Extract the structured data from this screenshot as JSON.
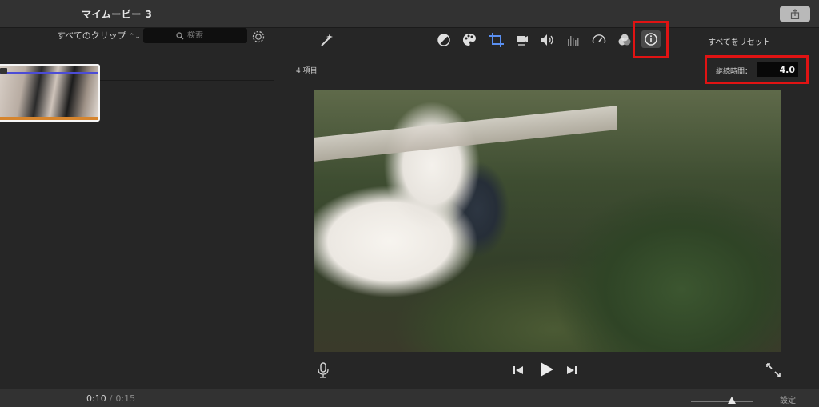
{
  "window": {
    "title": "マイムービー 3"
  },
  "browser": {
    "filter_label": "すべてのクリップ",
    "search_placeholder": "検索"
  },
  "viewer": {
    "items_count": "4 項目",
    "reset_all": "すべてをリセット",
    "duration_label": "継続時間：",
    "duration_value": "4.0",
    "toolbar_icons": [
      "magic-wand-icon",
      "color-balance-icon",
      "color-palette-icon",
      "crop-icon",
      "stabilization-icon",
      "volume-icon",
      "equalizer-icon",
      "speed-icon",
      "filter-icon",
      "info-icon"
    ]
  },
  "status": {
    "current_time": "0:10",
    "separator": "/",
    "total_time": "0:15",
    "settings_label": "設定"
  },
  "colors": {
    "accent_blue": "#5a8ff0",
    "highlight_red": "#e01313"
  }
}
